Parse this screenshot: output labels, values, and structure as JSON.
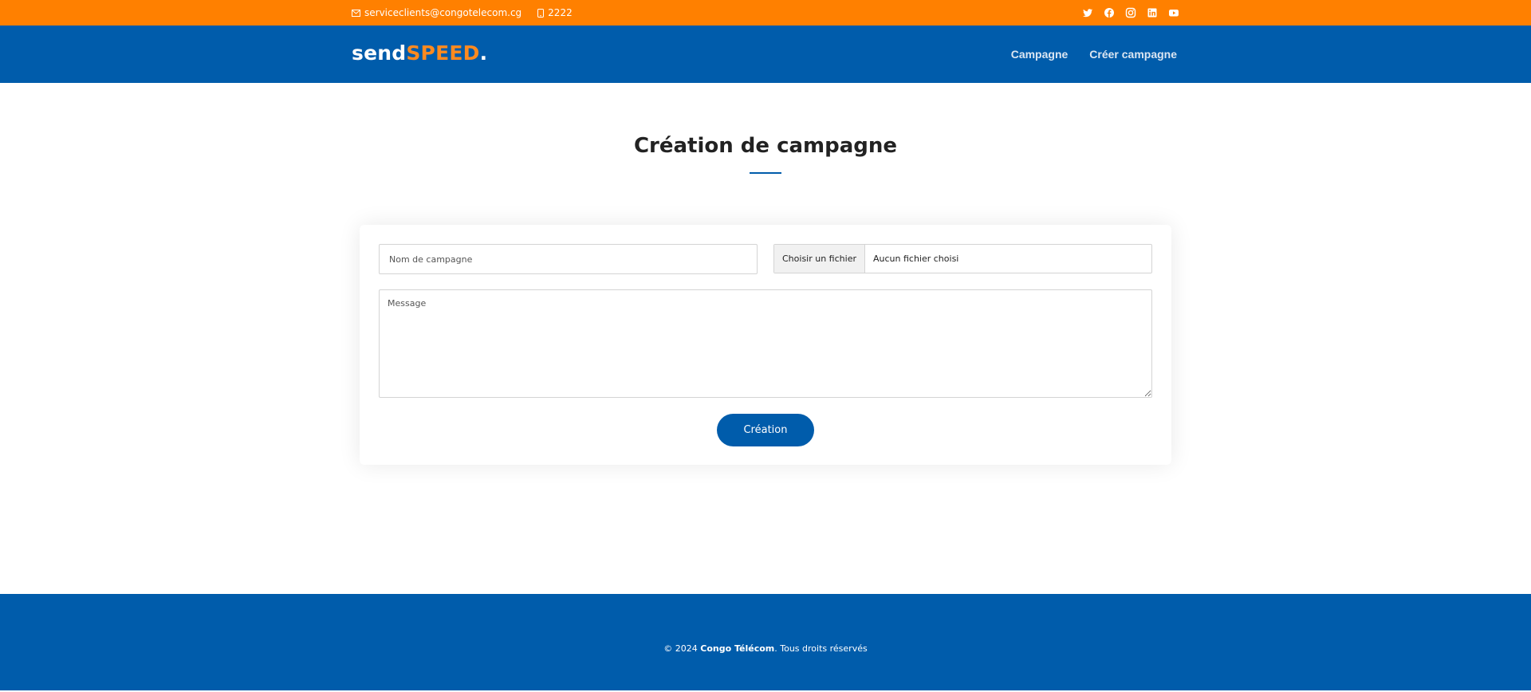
{
  "topbar": {
    "email": "serviceclients@congotelecom.cg",
    "phone": "2222",
    "email_icon": "envelope-icon",
    "phone_icon": "phone-icon",
    "social_icons": [
      "twitter-icon",
      "facebook-icon",
      "instagram-icon",
      "linkedin-icon",
      "youtube-icon"
    ],
    "color": "#ff8000"
  },
  "header": {
    "logo": {
      "part1": "send",
      "part2": "SPEED",
      "part3": "."
    },
    "nav": [
      "Campagne",
      "Créer campagne"
    ],
    "color": "#005cab"
  },
  "main": {
    "title": "Création de campagne",
    "form": {
      "name_placeholder": "Nom de campagne",
      "file_button": "Choisir un fichier",
      "file_status": "Aucun fichier choisi",
      "message_placeholder": "Message",
      "submit_label": "Création"
    }
  },
  "footer": {
    "prefix": "© 2024",
    "company": "Congo Télécom",
    "suffix": ". Tous droits réservés",
    "color": "#005cab"
  },
  "colors": {
    "accent": "#ff8000",
    "brand": "#005cab"
  }
}
